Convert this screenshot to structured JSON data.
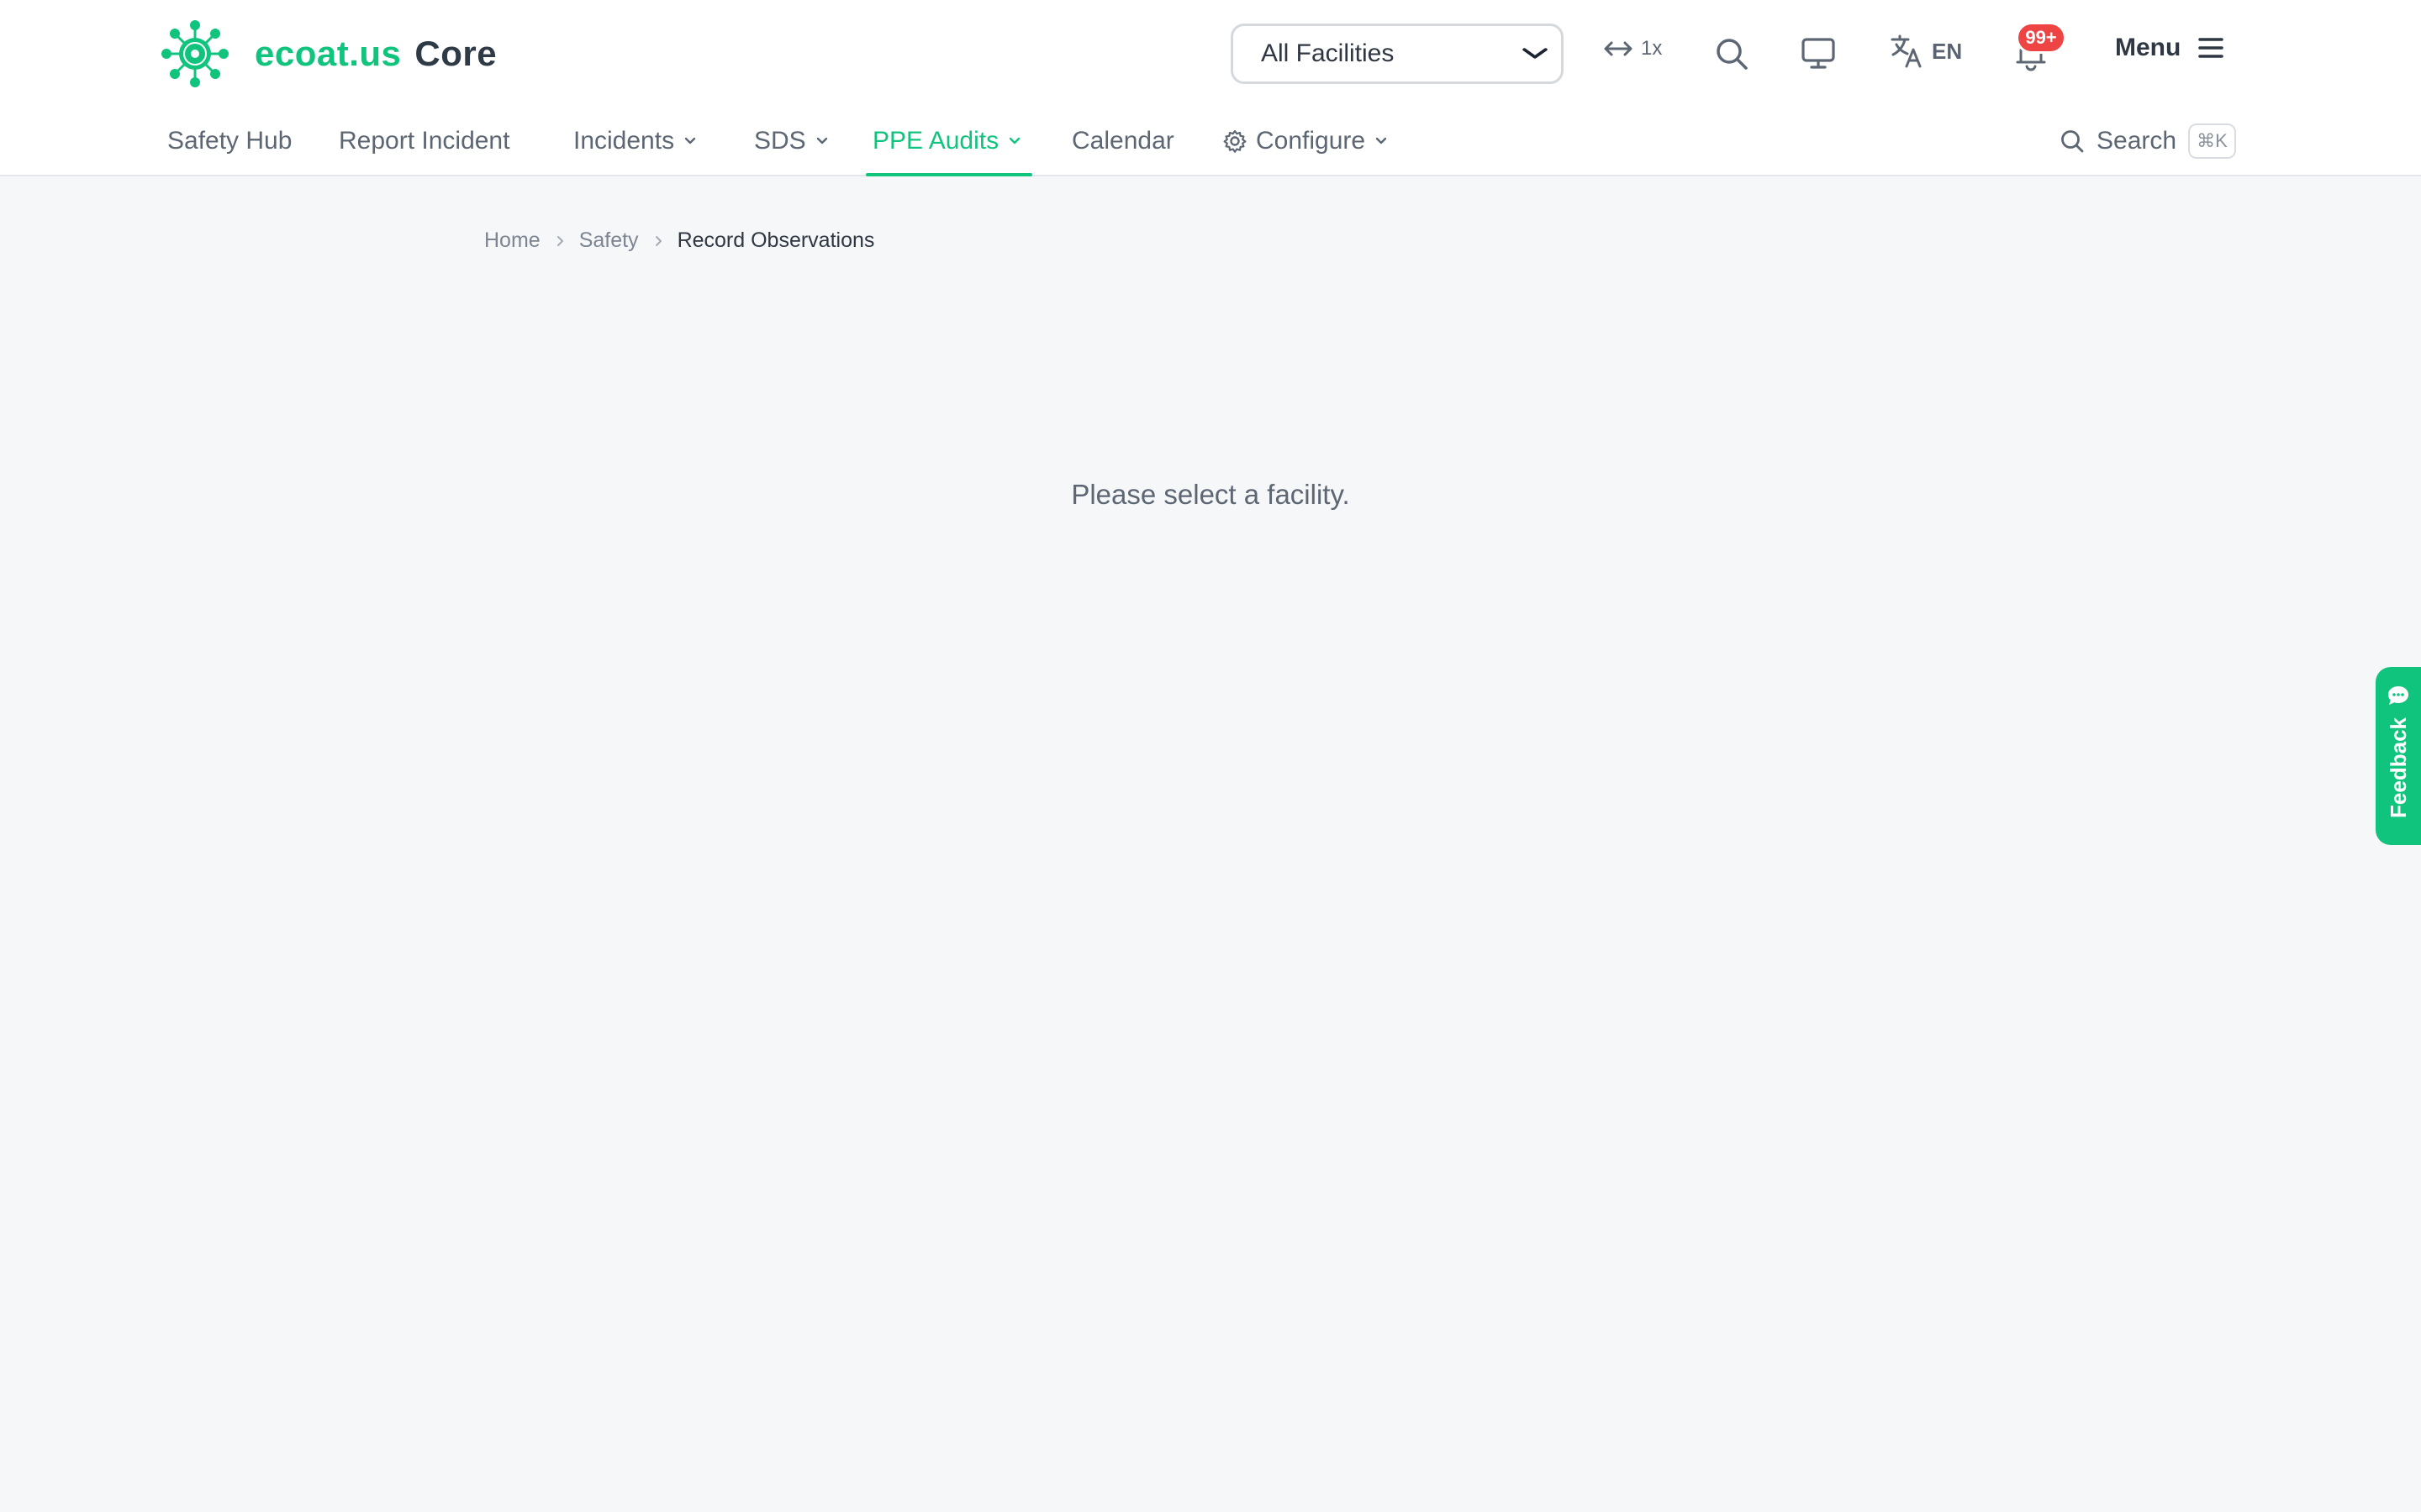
{
  "header": {
    "brand": {
      "name": "ecoat.us",
      "product": "Core"
    },
    "facility_select": {
      "selected": "All Facilities",
      "options": [
        "All Facilities"
      ]
    },
    "zoom": {
      "label": "1x"
    },
    "language": {
      "code": "EN"
    },
    "notifications": {
      "badge": "99+"
    },
    "menu": {
      "label": "Menu"
    }
  },
  "nav": {
    "items": [
      {
        "label": "Safety Hub"
      },
      {
        "label": "Report Incident"
      },
      {
        "label": "Incidents"
      },
      {
        "label": "SDS"
      },
      {
        "label": "PPE Audits"
      },
      {
        "label": "Calendar"
      },
      {
        "label": "Configure"
      }
    ],
    "search": {
      "label": "Search",
      "shortcut": "⌘K"
    }
  },
  "breadcrumb": [
    "Home",
    "Safety",
    "Record Observations"
  ],
  "main": {
    "message": "Please select a facility."
  },
  "feedback": {
    "label": "Feedback"
  },
  "colors": {
    "accent": "#10c47e",
    "badge": "#ef4444",
    "background": "#f6f7f9"
  }
}
